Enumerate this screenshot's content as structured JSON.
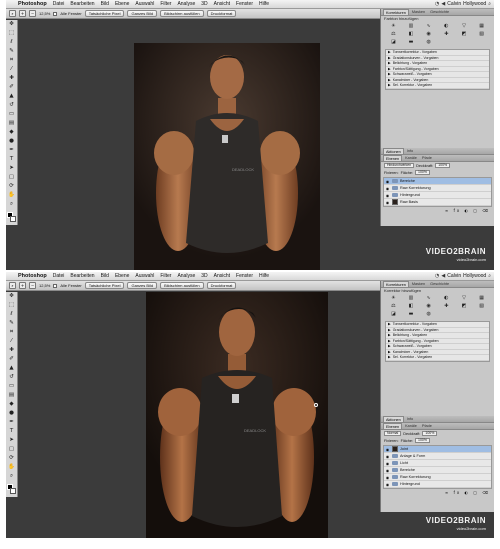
{
  "menubar": {
    "app_name": "Photoshop",
    "items": [
      "Datei",
      "Bearbeiten",
      "Bild",
      "Ebene",
      "Auswahl",
      "Filter",
      "Analyse",
      "3D",
      "Ansicht",
      "Fenster",
      "Hilfe"
    ],
    "user": "Calvin",
    "right_label": "Hollywood"
  },
  "options_bar": {
    "zoom": "12,5%",
    "checkbox_label": "Alle Fenster",
    "buttons": [
      "Tatsächliche Pixel",
      "Ganzes Bild",
      "Bildschirm ausfüllen",
      "Druckformat"
    ]
  },
  "top": {
    "panel_tabs": [
      "Korrekturen",
      "Masken",
      "Geschichte"
    ],
    "panel_heading": "Farbton hinzufügen",
    "presets": [
      "Tonwertkorrektur - Vorgaben",
      "Gradationskurven - Vorgaben",
      "Belichtung - Vorgaben",
      "Farbton/Sättigung - Vorgaben",
      "Schwarzweiß - Vorgaben",
      "Kanalmixer - Vorgaben",
      "Sel. Korrektur - Vorgaben"
    ],
    "layers_tabs": [
      "Ebenen",
      "Kanäle",
      "Pfade"
    ],
    "layers_tabs_top": [
      "Aktionen",
      "Info"
    ],
    "blend_mode": "Hindurchwirken",
    "opacity_label": "Deckkraft:",
    "opacity": "100%",
    "fill_label": "Fläche:",
    "fill": "100%",
    "lock_label": "Fixieren:",
    "layers": [
      {
        "name": "Bereiche",
        "kind": "folder",
        "active": true
      },
      {
        "name": "Raw Korrekturung",
        "kind": "folder",
        "active": false
      },
      {
        "name": "Hintergrund",
        "kind": "folder",
        "active": false
      },
      {
        "name": "Raw Basis",
        "kind": "image",
        "active": false
      }
    ]
  },
  "bottom": {
    "panel_tabs": [
      "Korrekturen",
      "Masken",
      "Geschichte"
    ],
    "panel_heading": "Korrektur hinzufügen",
    "presets": [
      "Tonwertkorrektur - Vorgaben",
      "Gradationskurven - Vorgaben",
      "Belichtung - Vorgaben",
      "Farbton/Sättigung - Vorgaben",
      "Schwarzweiß - Vorgaben",
      "Kanalmixer - Vorgaben",
      "Sel. Korrektur - Vorgaben"
    ],
    "layers_tabs": [
      "Ebenen",
      "Kanäle",
      "Pfade"
    ],
    "layers_tabs_top": [
      "Aktionen",
      "Info"
    ],
    "blend_mode": "Normal",
    "opacity_label": "Deckkraft:",
    "opacity": "100%",
    "fill_label": "Fläche:",
    "fill": "100%",
    "lock_label": "Fixieren:",
    "layers": [
      {
        "name": "Joint",
        "kind": "image",
        "active": true
      },
      {
        "name": "Anlage & Form",
        "kind": "folder",
        "active": false
      },
      {
        "name": "Licht",
        "kind": "folder",
        "active": false
      },
      {
        "name": "Bereiche",
        "kind": "folder",
        "active": false
      },
      {
        "name": "Raw Korrekturung",
        "kind": "folder",
        "active": false
      },
      {
        "name": "Hintergrund",
        "kind": "folder",
        "active": false
      }
    ]
  },
  "watermark": {
    "brand_left": "VIDEO",
    "brand_right": "BRAIN",
    "url": "video2brain.com"
  },
  "shirt_text": "DEADLOCK",
  "colors": {
    "workspace": "#3b3b3b",
    "doc_bg": "#1c1512",
    "active_layer": "#9fbde3"
  }
}
